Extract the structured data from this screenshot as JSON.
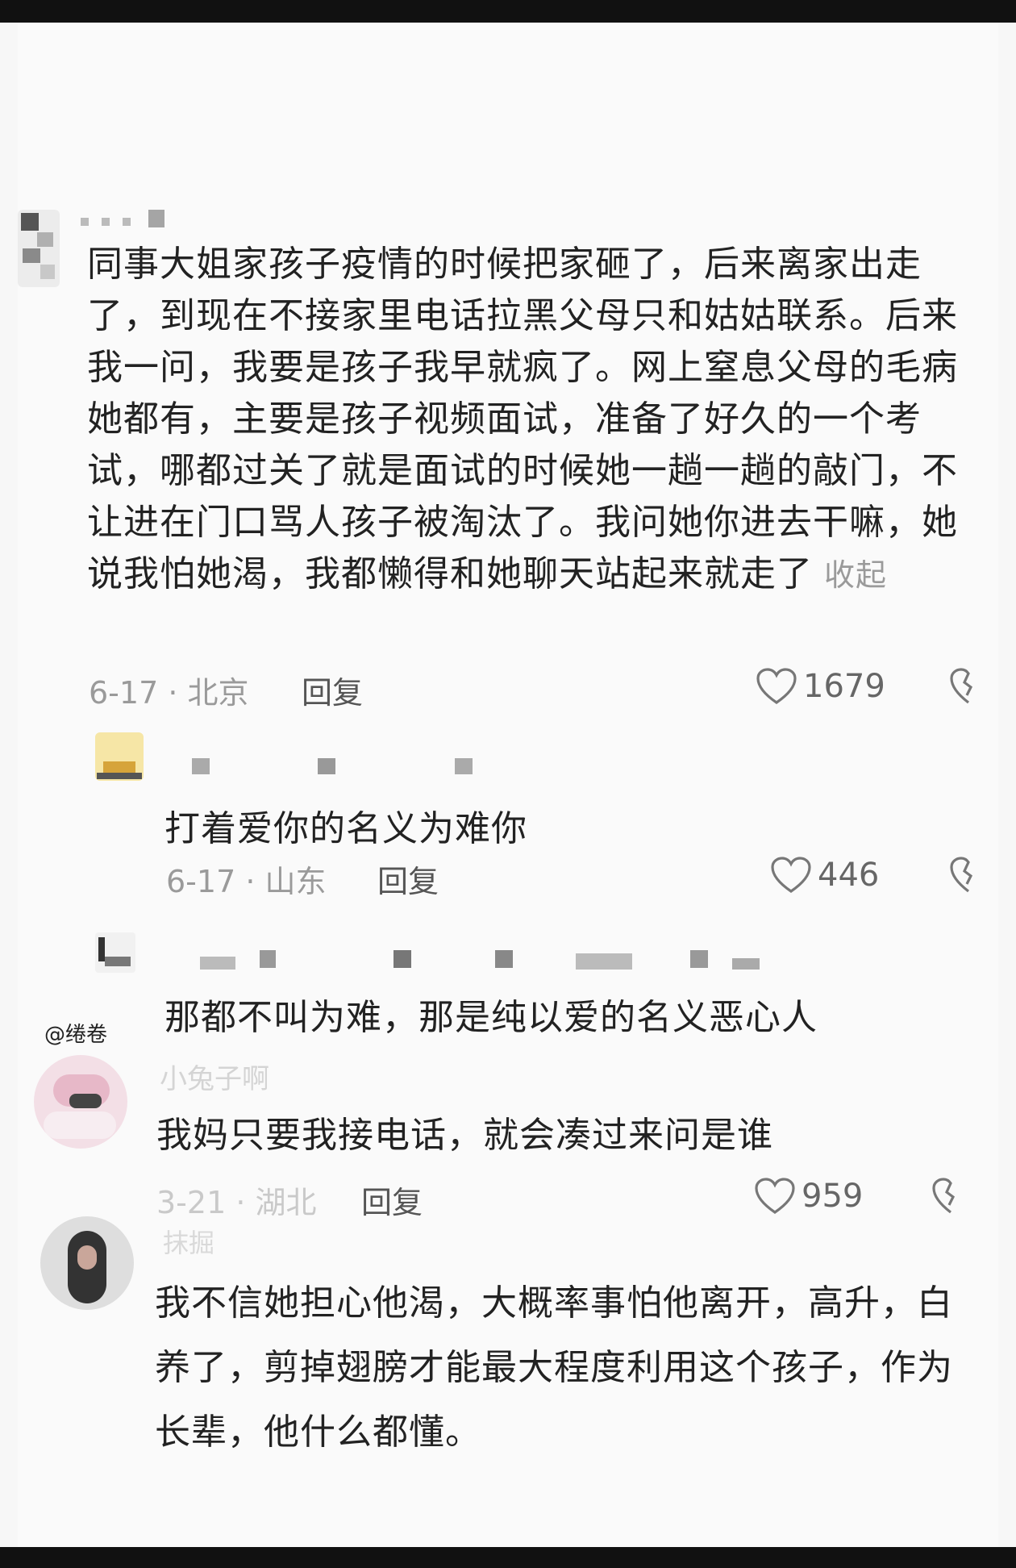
{
  "watermark": "",
  "credit": "@绻卷",
  "comments": [
    {
      "text": "同事大姐家孩子疫情的时候把家砸了，后来离家出走了，到现在不接家里电话拉黑父母只和姑姑联系。后来我一问，我要是孩子我早就疯了。网上窒息父母的毛病她都有，主要是孩子视频面试，准备了好久的一个考试，哪都过关了就是面试的时候她一趟一趟的敲门，不让进在门口骂人孩子被淘汰了。我问她你进去干嘛，她说我怕她渴，我都懒得和她聊天站起来就走了",
      "collapse": "收起",
      "meta": "6-17 · 北京",
      "reply": "回复",
      "likes": "1679"
    },
    {
      "text": "打着爱你的名义为难你",
      "meta": "6-17 · 山东",
      "reply": "回复",
      "likes": "446"
    },
    {
      "text": "那都不叫为难，那是纯以爱的名义恶心人"
    },
    {
      "name": "小兔子啊",
      "text": "我妈只要我接电话，就会凑过来问是谁",
      "meta": "3-21 · 湖北",
      "reply": "回复",
      "likes": "959"
    },
    {
      "name": "抹掘",
      "text": "我不信她担心他渴，大概率事怕他离开，高升，白养了，剪掉翅膀才能最大程度利用这个孩子，作为长辈，他什么都懂。"
    }
  ]
}
